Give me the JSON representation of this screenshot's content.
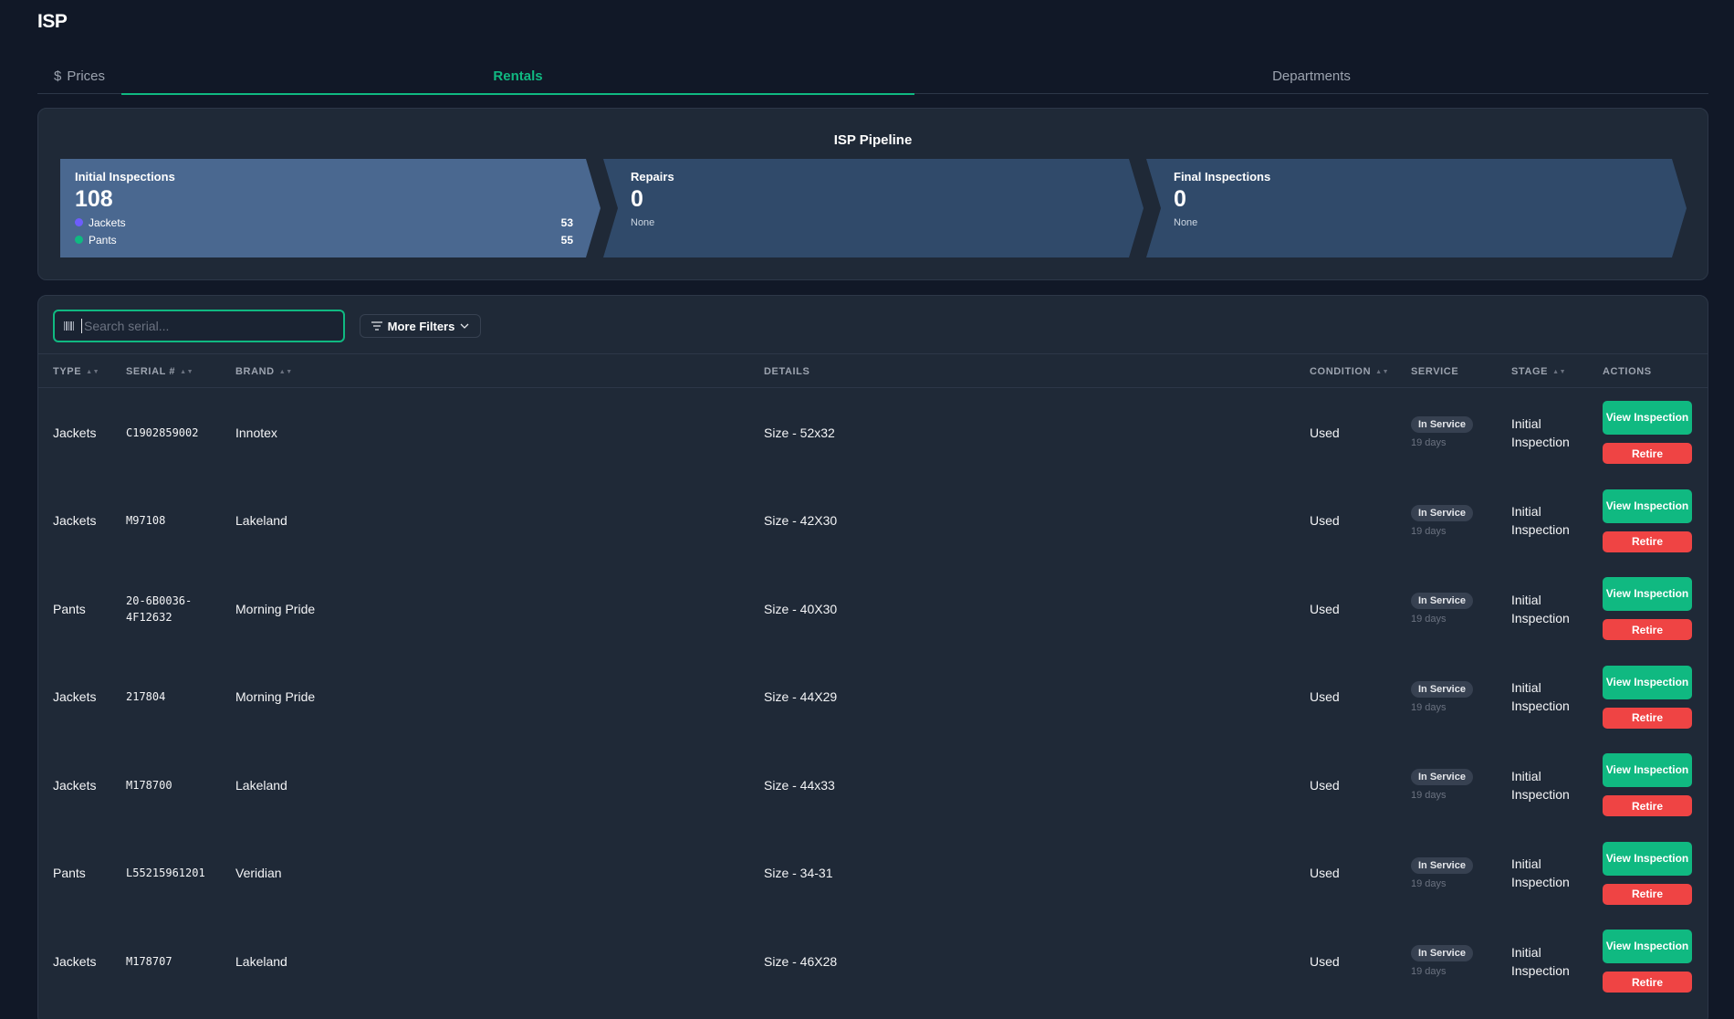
{
  "app": {
    "title": "ISP"
  },
  "tabs": [
    {
      "label": "Prices",
      "icon": "dollar-icon",
      "icon_glyph": "$"
    },
    {
      "label": "Rentals",
      "active": true
    },
    {
      "label": "Departments"
    }
  ],
  "colors": {
    "accent": "#10b981",
    "danger": "#ef4444",
    "jackets": "#6d5dfc",
    "pants": "#10b981"
  },
  "pipeline": {
    "title": "ISP Pipeline",
    "stages": [
      {
        "name": "Initial Inspections",
        "count": "108",
        "breakdown": [
          {
            "label": "Jackets",
            "value": "53"
          },
          {
            "label": "Pants",
            "value": "55"
          }
        ]
      },
      {
        "name": "Repairs",
        "count": "0",
        "empty_text": "None"
      },
      {
        "name": "Final Inspections",
        "count": "0",
        "empty_text": "None"
      }
    ]
  },
  "search": {
    "placeholder": "Search serial...",
    "value": ""
  },
  "filters": {
    "label": "More Filters"
  },
  "table": {
    "headers": {
      "type": "TYPE",
      "serial": "SERIAL #",
      "brand": "BRAND",
      "details": "DETAILS",
      "condition": "CONDITION",
      "service": "SERVICE",
      "stage": "STAGE",
      "actions": "ACTIONS"
    },
    "rows": [
      {
        "type": "Jackets",
        "serial": "C1902859002",
        "brand": "Innotex",
        "details": "Size - 52x32",
        "condition": "Used",
        "service": "In Service",
        "service_days": "19 days",
        "stage": "Initial Inspection",
        "view_label": "View Inspection",
        "retire_label": "Retire"
      },
      {
        "type": "Jackets",
        "serial": "M97108",
        "brand": "Lakeland",
        "details": "Size - 42X30",
        "condition": "Used",
        "service": "In Service",
        "service_days": "19 days",
        "stage": "Initial Inspection",
        "view_label": "View Inspection",
        "retire_label": "Retire"
      },
      {
        "type": "Pants",
        "serial": "20-6B0036-4F12632",
        "brand": "Morning Pride",
        "details": "Size - 40X30",
        "condition": "Used",
        "service": "In Service",
        "service_days": "19 days",
        "stage": "Initial Inspection",
        "view_label": "View Inspection",
        "retire_label": "Retire"
      },
      {
        "type": "Jackets",
        "serial": "217804",
        "brand": "Morning Pride",
        "details": "Size - 44X29",
        "condition": "Used",
        "service": "In Service",
        "service_days": "19 days",
        "stage": "Initial Inspection",
        "view_label": "View Inspection",
        "retire_label": "Retire"
      },
      {
        "type": "Jackets",
        "serial": "M178700",
        "brand": "Lakeland",
        "details": "Size - 44x33",
        "condition": "Used",
        "service": "In Service",
        "service_days": "19 days",
        "stage": "Initial Inspection",
        "view_label": "View Inspection",
        "retire_label": "Retire"
      },
      {
        "type": "Pants",
        "serial": "L55215961201",
        "brand": "Veridian",
        "details": "Size - 34-31",
        "condition": "Used",
        "service": "In Service",
        "service_days": "19 days",
        "stage": "Initial Inspection",
        "view_label": "View Inspection",
        "retire_label": "Retire"
      },
      {
        "type": "Jackets",
        "serial": "M178707",
        "brand": "Lakeland",
        "details": "Size - 46X28",
        "condition": "Used",
        "service": "In Service",
        "service_days": "19 days",
        "stage": "Initial Inspection",
        "view_label": "View Inspection",
        "retire_label": "Retire"
      }
    ]
  }
}
